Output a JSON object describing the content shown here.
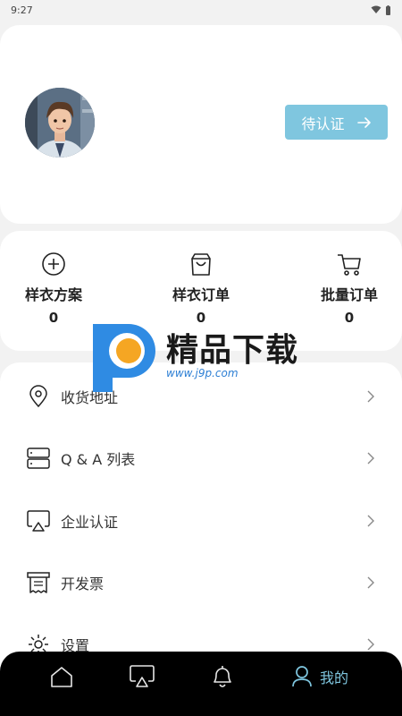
{
  "status_bar": {
    "time": "9:27"
  },
  "profile": {
    "pending_button_label": "待认证",
    "avatar_icon": "avatar-image"
  },
  "orders": [
    {
      "label": "样衣方案",
      "count": "0",
      "icon": "plus-circle-icon"
    },
    {
      "label": "样衣订单",
      "count": "0",
      "icon": "shopping-bag-icon"
    },
    {
      "label": "批量订单",
      "count": "0",
      "icon": "cart-icon"
    }
  ],
  "menu": [
    {
      "label": "收货地址",
      "icon": "location-pin-icon"
    },
    {
      "label": "Q & A 列表",
      "icon": "server-list-icon"
    },
    {
      "label": "企业认证",
      "icon": "airplay-icon"
    },
    {
      "label": "开发票",
      "icon": "receipt-icon"
    },
    {
      "label": "设置",
      "icon": "gear-icon"
    }
  ],
  "watermark": {
    "text": "精品下载",
    "url": "www.j9p.com"
  },
  "tab_bar": {
    "tabs": [
      {
        "icon": "home-icon",
        "label": ""
      },
      {
        "icon": "airplay-icon",
        "label": ""
      },
      {
        "icon": "bell-icon",
        "label": ""
      },
      {
        "icon": "person-icon",
        "label": "我的",
        "active": true
      }
    ],
    "accent_color": "#7fc6df"
  }
}
